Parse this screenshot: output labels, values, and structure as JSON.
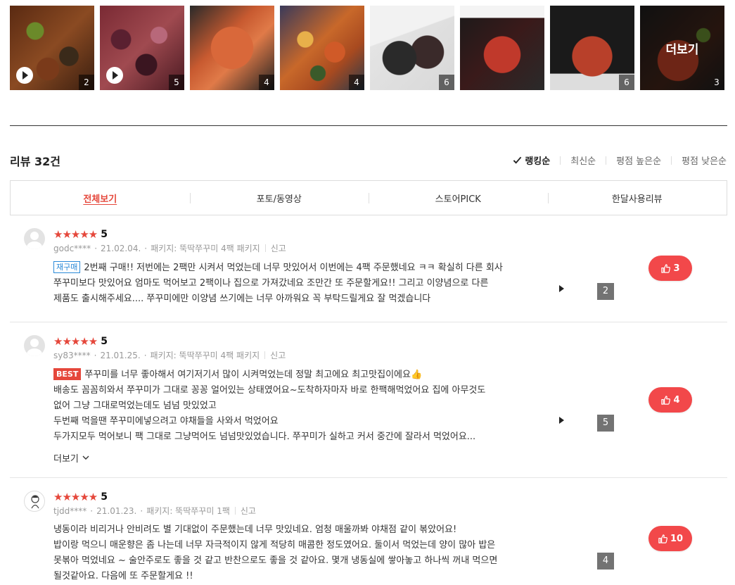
{
  "photo_strip": [
    {
      "count": "2",
      "video": true
    },
    {
      "count": "5",
      "video": true
    },
    {
      "count": "4",
      "video": false
    },
    {
      "count": "4",
      "video": false
    },
    {
      "count": "6",
      "video": false
    },
    {
      "count": "",
      "video": false
    },
    {
      "count": "6",
      "video": false
    },
    {
      "count": "3",
      "video": false,
      "more_label": "더보기"
    }
  ],
  "header": {
    "title": "리뷰 32건",
    "sort_options": [
      "랭킹순",
      "최신순",
      "평점 높은순",
      "평점 낮은순"
    ],
    "sort_active": "랭킹순"
  },
  "tabs": [
    "전체보기",
    "포토/동영상",
    "스토어PICK",
    "한달사용리뷰"
  ],
  "tab_active": "전체보기",
  "reviews": [
    {
      "stars": "★★★★★",
      "rating": "5",
      "user": "godc****",
      "date": "21.02.04.",
      "option": "패키지: 뚝딱쭈꾸미 4팩 패키지",
      "report": "신고",
      "badge": "재구매",
      "lines": [
        "2번째 구매!! 저번에는 2팩만 시켜서 먹었는데 너무 맛있어서 이번에는 4팩 주문했네요 ㅋㅋ 확실히 다른 회사",
        "쭈꾸미보다 맛있어요 엄마도 먹어보고 2팩이나 집으로 가져갔네요 조만간 또 주문할게요!! 그리고 이양념으로 다른",
        "제품도 출시해주세요.... 쭈꾸미에만 이양념 쓰기에는 너무 아까워요 꼭 부탁드릴게요 잘 먹겠습니다"
      ],
      "photo_count": "2",
      "likes": "3"
    },
    {
      "stars": "★★★★★",
      "rating": "5",
      "user": "sy83****",
      "date": "21.01.25.",
      "option": "패키지: 뚝딱쭈꾸미 4팩 패키지",
      "report": "신고",
      "badge": "BEST",
      "lines": [
        "쭈꾸미를 너무 좋아해서 여기저기서 많이 시켜먹었는데 정말 최고에요 최고맛집이에요👍",
        "배송도 꼼꼼히와서 쭈꾸미가 그대로 꽁꽁 얼어있는 상태였어요~도착하자마자 바로 한팩해먹었어요 집에 아무것도",
        "없어 그냥 그대로먹었는데도 넘넘 맛있었고",
        "두번째 먹을땐 쭈꾸미에넣으려고 야채들을 사와서 먹었어요",
        "두가지모두 먹어보니 팩 그대로 그냥먹어도 넘넘맛있었습니다. 쭈꾸미가 실하고 커서 중간에 잘라서 먹었어요..."
      ],
      "more_label": "더보기",
      "photo_count": "5",
      "likes": "4"
    },
    {
      "stars": "★★★★★",
      "rating": "5",
      "user": "tjdd****",
      "date": "21.01.23.",
      "option": "패키지: 뚝딱쭈꾸미 1팩",
      "report": "신고",
      "lines": [
        "냉동이라 비리거나 안비려도 별 기대없이 주문했는데 너무 맛있네요. 엄청 매울까봐 야채점 같이 볶았어요!",
        "밥이랑 먹으니 매운향은 좀 나는데 너무 자극적이지 않게 적당히 매콤한 정도였어요. 둘이서 먹었는데 양이 많아 밥은",
        "못볶아 먹었네요 ~ 술안주로도 좋을 것 같고 반찬으로도 좋을 것 같아요. 몇개 냉동실에 쌓아놓고 하나씩 꺼내 먹으면",
        "될것같아요. 다음에 또 주문할게요 !!"
      ],
      "photo_count": "4",
      "likes": "10"
    }
  ]
}
